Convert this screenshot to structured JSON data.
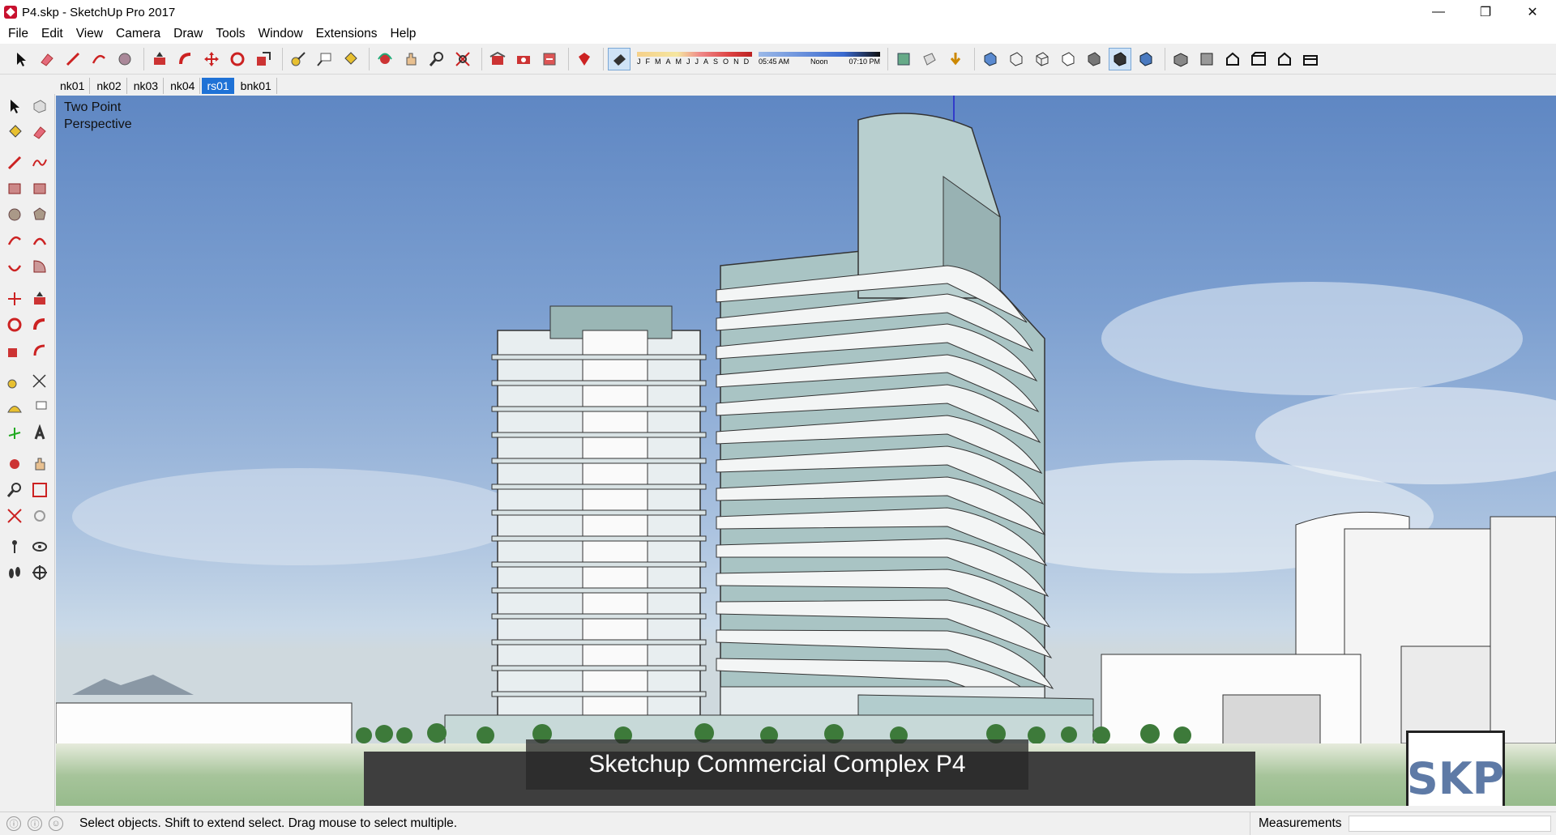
{
  "window": {
    "title": "P4.skp - SketchUp Pro 2017",
    "minimize_glyph": "—",
    "maximize_glyph": "❐",
    "close_glyph": "✕"
  },
  "menu": [
    "File",
    "Edit",
    "View",
    "Camera",
    "Draw",
    "Tools",
    "Window",
    "Extensions",
    "Help"
  ],
  "shadow_settings": {
    "months": [
      "J",
      "F",
      "M",
      "A",
      "M",
      "J",
      "J",
      "A",
      "S",
      "O",
      "N",
      "D"
    ],
    "time_start": "05:45 AM",
    "time_mid": "Noon",
    "time_end": "07:10 PM"
  },
  "scene_tabs": [
    "nk01",
    "nk02",
    "nk03",
    "nk04",
    "rs01",
    "bnk01"
  ],
  "active_scene": "rs01",
  "viewport": {
    "camera_label_line1": "Two Point",
    "camera_label_line2": "Perspective",
    "caption": "Sketchup Commercial Complex P4",
    "watermark": "SKP"
  },
  "status": {
    "message": "Select objects. Shift to extend select. Drag mouse to select multiple.",
    "measurements_label": "Measurements",
    "measurements_value": ""
  },
  "colors": {
    "accent": "#1f72d6",
    "sky_top": "#5f87c3",
    "brand_red": "#c8102e"
  }
}
